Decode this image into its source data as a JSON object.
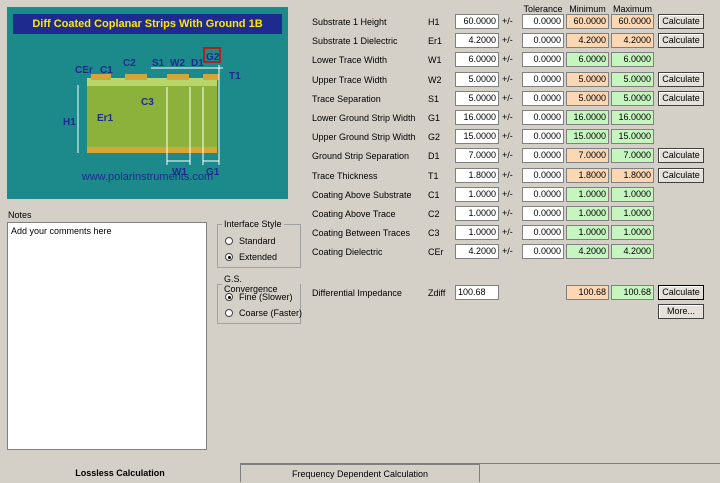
{
  "diagram": {
    "title": "Diff Coated Coplanar Strips With Ground  1B",
    "url": "www.polarinstruments.com",
    "labels": [
      "CEr",
      "C1",
      "C2",
      "S1",
      "W2",
      "D1",
      "G2",
      "T1",
      "H1",
      "Er1",
      "C3",
      "W1",
      "G1"
    ]
  },
  "notes": {
    "label": "Notes",
    "text": "Add your comments here"
  },
  "interface_style": {
    "title": "Interface Style",
    "options": [
      "Standard",
      "Extended"
    ],
    "selected": "Extended"
  },
  "convergence": {
    "title": "G.S. Convergence",
    "options": [
      "Fine (Slower)",
      "Coarse (Faster)"
    ],
    "selected": "Fine (Slower)"
  },
  "headers": {
    "tolerance": "Tolerance",
    "minimum": "Minimum",
    "maximum": "Maximum"
  },
  "plusminus": "+/-",
  "rows": [
    {
      "name": "Substrate 1 Height",
      "sym": "H1",
      "val": "60.0000",
      "tol": "0.0000",
      "min": "60.0000",
      "max": "60.0000",
      "btn": "Calculate"
    },
    {
      "name": "Substrate 1 Dielectric",
      "sym": "Er1",
      "val": "4.2000",
      "tol": "0.0000",
      "min": "4.2000",
      "max": "4.2000",
      "btn": "Calculate"
    },
    {
      "name": "Lower Trace Width",
      "sym": "W1",
      "val": "6.0000",
      "tol": "0.0000",
      "min": "6.0000",
      "max": "6.0000",
      "btn": ""
    },
    {
      "name": "Upper Trace Width",
      "sym": "W2",
      "val": "5.0000",
      "tol": "0.0000",
      "min": "5.0000",
      "max": "5.0000",
      "btn": "Calculate"
    },
    {
      "name": "Trace Separation",
      "sym": "S1",
      "val": "5.0000",
      "tol": "0.0000",
      "min": "5.0000",
      "max": "5.0000",
      "btn": "Calculate"
    },
    {
      "name": "Lower Ground Strip Width",
      "sym": "G1",
      "val": "16.0000",
      "tol": "0.0000",
      "min": "16.0000",
      "max": "16.0000",
      "btn": ""
    },
    {
      "name": "Upper Ground Strip Width",
      "sym": "G2",
      "val": "15.0000",
      "tol": "0.0000",
      "min": "15.0000",
      "max": "15.0000",
      "btn": ""
    },
    {
      "name": "Ground Strip Separation",
      "sym": "D1",
      "val": "7.0000",
      "tol": "0.0000",
      "min": "7.0000",
      "max": "7.0000",
      "btn": "Calculate"
    },
    {
      "name": "Trace Thickness",
      "sym": "T1",
      "val": "1.8000",
      "tol": "0.0000",
      "min": "1.8000",
      "max": "1.8000",
      "btn": "Calculate"
    },
    {
      "name": "Coating Above Substrate",
      "sym": "C1",
      "val": "1.0000",
      "tol": "0.0000",
      "min": "1.0000",
      "max": "1.0000",
      "btn": ""
    },
    {
      "name": "Coating Above Trace",
      "sym": "C2",
      "val": "1.0000",
      "tol": "0.0000",
      "min": "1.0000",
      "max": "1.0000",
      "btn": ""
    },
    {
      "name": "Coating Between Traces",
      "sym": "C3",
      "val": "1.0000",
      "tol": "0.0000",
      "min": "1.0000",
      "max": "1.0000",
      "btn": ""
    },
    {
      "name": "Coating Dielectric",
      "sym": "CEr",
      "val": "4.2000",
      "tol": "0.0000",
      "min": "4.2000",
      "max": "4.2000",
      "btn": ""
    }
  ],
  "impedance": {
    "name": "Differential Impedance",
    "sym": "Zdiff",
    "val": "100.68",
    "min": "100.68",
    "max": "100.68",
    "btn": "Calculate",
    "more": "More..."
  },
  "tabs": {
    "lossless": "Lossless Calculation",
    "frequency": "Frequency Dependent Calculation"
  },
  "colors": {
    "minimum": "#fcd7b4",
    "maximum": "#c6f5c0",
    "maximum_alt": "#fcd7b4"
  }
}
